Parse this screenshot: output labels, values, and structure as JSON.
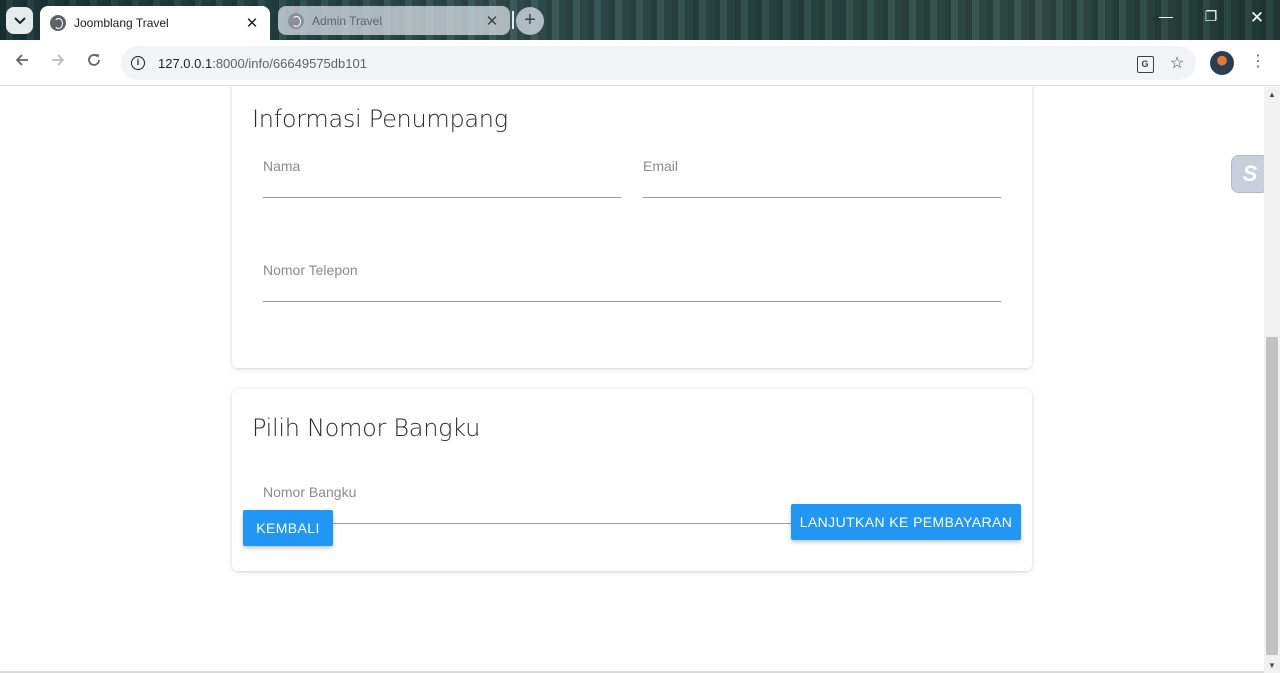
{
  "browser": {
    "tabs": [
      {
        "title": "Joomblang Travel",
        "active": true
      },
      {
        "title": "Admin Travel",
        "active": false
      }
    ],
    "new_tab_label": "+",
    "url_host": "127.0.0.1",
    "url_rest": ":8000/info/66649575db101",
    "window_controls": {
      "minimize": "—",
      "maximize": "❐",
      "close": "✕"
    }
  },
  "page": {
    "passenger_card": {
      "title": "Informasi Penumpang",
      "fields": {
        "name": {
          "label": "Nama",
          "value": ""
        },
        "email": {
          "label": "Email",
          "value": ""
        },
        "phone": {
          "label": "Nomor Telepon",
          "value": ""
        }
      }
    },
    "seat_card": {
      "title": "Pilih Nomor Bangku",
      "fields": {
        "seat": {
          "label": "Nomor Bangku",
          "value": ""
        }
      }
    },
    "buttons": {
      "back": "KEMBALI",
      "next": "LANJUTKAN KE PEMBAYARAN"
    }
  },
  "colors": {
    "primary_button": "#2196f3"
  }
}
